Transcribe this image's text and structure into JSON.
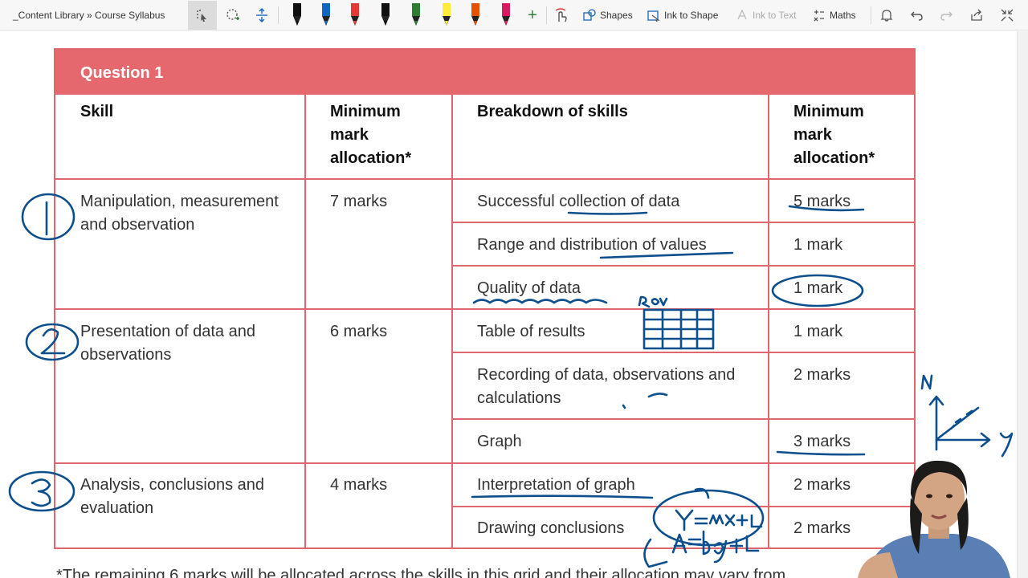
{
  "breadcrumb": "_Content Library » Course Syllabus",
  "toolbar": {
    "shapes_label": "Shapes",
    "ink_to_shape_label": "Ink to Shape",
    "ink_to_text_label": "Ink to Text",
    "maths_label": "Maths",
    "add_pen_symbol": "+",
    "pen_colors": [
      "#111111",
      "#1565c0",
      "#e53935",
      "#111111",
      "#2e7d32",
      "#ffeb3b",
      "#e65100",
      "#d81b60"
    ]
  },
  "table": {
    "title": "Question 1",
    "headers": {
      "skill": "Skill",
      "min_mark_1": "Minimum mark allocation*",
      "breakdown": "Breakdown of skills",
      "min_mark_2": "Minimum mark allocation*"
    },
    "groups": [
      {
        "skill": "Manipulation, measurement and observation",
        "marks": "7 marks",
        "rows": [
          {
            "breakdown": "Successful collection of data",
            "marks": "5 marks"
          },
          {
            "breakdown": "Range and distribution of values",
            "marks": "1 mark"
          },
          {
            "breakdown": "Quality of data",
            "marks": "1 mark"
          }
        ]
      },
      {
        "skill": "Presentation of data and observations",
        "marks": "6 marks",
        "rows": [
          {
            "breakdown": "Table of results",
            "marks": "1 mark"
          },
          {
            "breakdown": "Recording of data, observations and calculations",
            "marks": "2 marks"
          },
          {
            "breakdown": "Graph",
            "marks": "3 marks"
          }
        ]
      },
      {
        "skill": "Analysis, conclusions and evaluation",
        "marks": "4 marks",
        "rows": [
          {
            "breakdown": "Interpretation of graph",
            "marks": "2 marks"
          },
          {
            "breakdown": "Drawing conclusions",
            "marks": "2 marks"
          }
        ]
      }
    ]
  },
  "footnote": "*The remaining 6 marks will be allocated across the skills in this grid and their allocation may vary from",
  "ink": {
    "color": "#0d4f8c",
    "annotations": [
      "1",
      "2",
      "3",
      "Row",
      "N",
      "y",
      "Y=mx+c",
      "A=bq+c"
    ]
  }
}
